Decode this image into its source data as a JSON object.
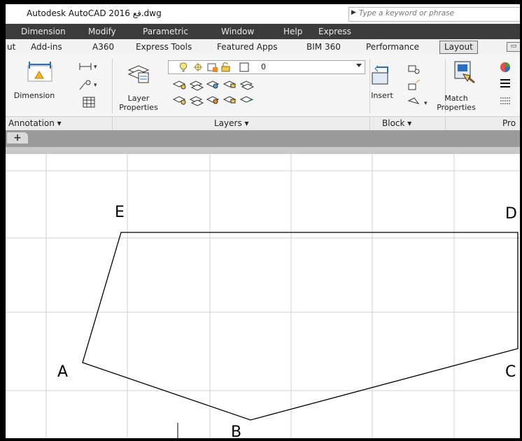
{
  "window": {
    "title": "Autodesk AutoCAD 2016   قع.dwg",
    "search_placeholder": "Type a keyword or phrase"
  },
  "menu": [
    "Dimension",
    "Modify",
    "Parametric",
    "Window",
    "Help",
    "Express"
  ],
  "ribbon_tabs": {
    "items": [
      "ut",
      "Add-ins",
      "A360",
      "Express Tools",
      "Featured Apps",
      "BIM 360",
      "Performance",
      "Layout"
    ],
    "active": "Layout"
  },
  "ribbon": {
    "dimension_label": "Dimension",
    "layer_properties_label": "Layer\nProperties",
    "layer_current": "0",
    "insert_label": "Insert",
    "match_properties_label": "Match\nProperties"
  },
  "panels": {
    "annotation": "Annotation ▾",
    "layers": "Layers ▾",
    "block": "Block ▾",
    "properties": "Pro"
  },
  "doc_tabs": {
    "new_tab": "+"
  },
  "drawing": {
    "points": {
      "A": "A",
      "B": "B",
      "C": "C",
      "D": "D",
      "E": "E"
    },
    "stroke_color": "#000000",
    "grid_color": "#d0d0d0"
  }
}
